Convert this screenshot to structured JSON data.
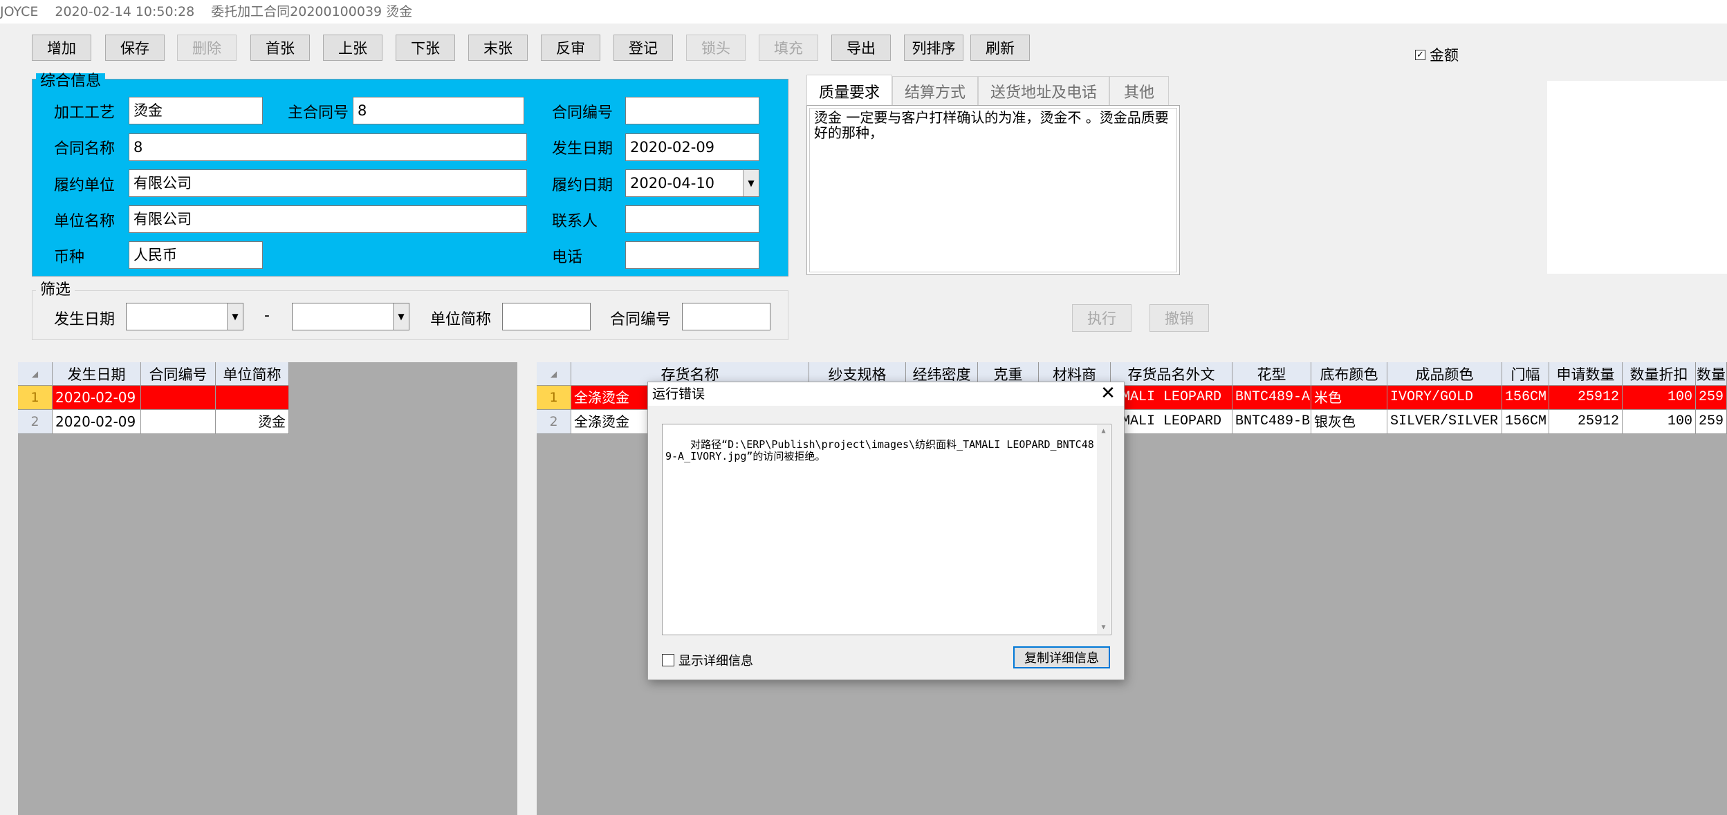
{
  "titlebar": {
    "app": "JOYCE",
    "datetime": "2020-02-14 10:50:28",
    "doc": "委托加工合同20200100039 烫金"
  },
  "toolbar": {
    "add": "增加",
    "save": "保存",
    "delete": "删除",
    "first": "首张",
    "prev": "上张",
    "next": "下张",
    "last": "末张",
    "unaudit": "反审",
    "register": "登记",
    "lock": "锁头",
    "fill": "填充",
    "export": "导出",
    "sort": "列排序",
    "refresh": "刷新"
  },
  "amount_checkbox": {
    "label": "金额",
    "checked": true
  },
  "general": {
    "title": "综合信息",
    "process_label": "加工工艺",
    "process_value": "烫金",
    "main_contract_label": "主合同号",
    "main_contract_value": "8",
    "contract_no_label": "合同编号",
    "contract_no_value": "",
    "contract_name_label": "合同名称",
    "contract_name_value": "8",
    "date_label": "发生日期",
    "date_value": "2020-02-09",
    "performer_label": "履约单位",
    "performer_value": "有限公司",
    "perform_date_label": "履约日期",
    "perform_date_value": "2020-04-10",
    "unit_label": "单位名称",
    "unit_value": "有限公司",
    "contact_label": "联系人",
    "contact_value": "",
    "currency_label": "币种",
    "currency_value": "人民币",
    "phone_label": "电话",
    "phone_value": ""
  },
  "tabs": [
    "质量要求",
    "结算方式",
    "送货地址及电话",
    "其他"
  ],
  "quality_text": "烫金 一定要与客户打样确认的为准，烫金不 。烫金品质要好的那种，",
  "filter": {
    "title": "筛选",
    "date_label": "发生日期",
    "dash": "-",
    "unit_label": "单位简称",
    "contract_label": "合同编号",
    "exec_btn": "执行",
    "cancel_btn": "撤销"
  },
  "left_grid": {
    "headers": [
      "发生日期",
      "合同编号",
      "单位简称"
    ],
    "rows": [
      {
        "num": "1",
        "date": "2020-02-09",
        "contract": "",
        "unit": ""
      },
      {
        "num": "2",
        "date": "2020-02-09",
        "contract": "",
        "unit": "烫金"
      }
    ]
  },
  "right_grid": {
    "headers": [
      "存货名称",
      "纱支规格",
      "经纬密度",
      "克重",
      "材料商",
      "存货品名外文",
      "花型",
      "底布颜色",
      "成品颜色",
      "门幅",
      "申请数量",
      "数量折扣",
      "数量"
    ],
    "rows": [
      {
        "num": "1",
        "name": "全涤烫金",
        "foreign": "AMALI LEOPARD",
        "pattern": "BNTC489-A",
        "base": "米色",
        "color": "IVORY/GOLD",
        "width": "156CM",
        "qty": "25912",
        "discount": "100",
        "amount": "259"
      },
      {
        "num": "2",
        "name": "全涤烫金",
        "foreign": "AMALI LEOPARD",
        "pattern": "BNTC489-B",
        "base": "银灰色",
        "color": "SILVER/SILVER",
        "width": "156CM",
        "qty": "25912",
        "discount": "100",
        "amount": "259"
      }
    ]
  },
  "dialog": {
    "title": "运行错误",
    "message": "对路径“D:\\ERP\\Publish\\project\\images\\纺织面料_TAMALI LEOPARD_BNTC489-A_IVORY.jpg”的访问被拒绝。",
    "show_details": "显示详细信息",
    "copy_details": "复制详细信息",
    "close": "✕"
  }
}
